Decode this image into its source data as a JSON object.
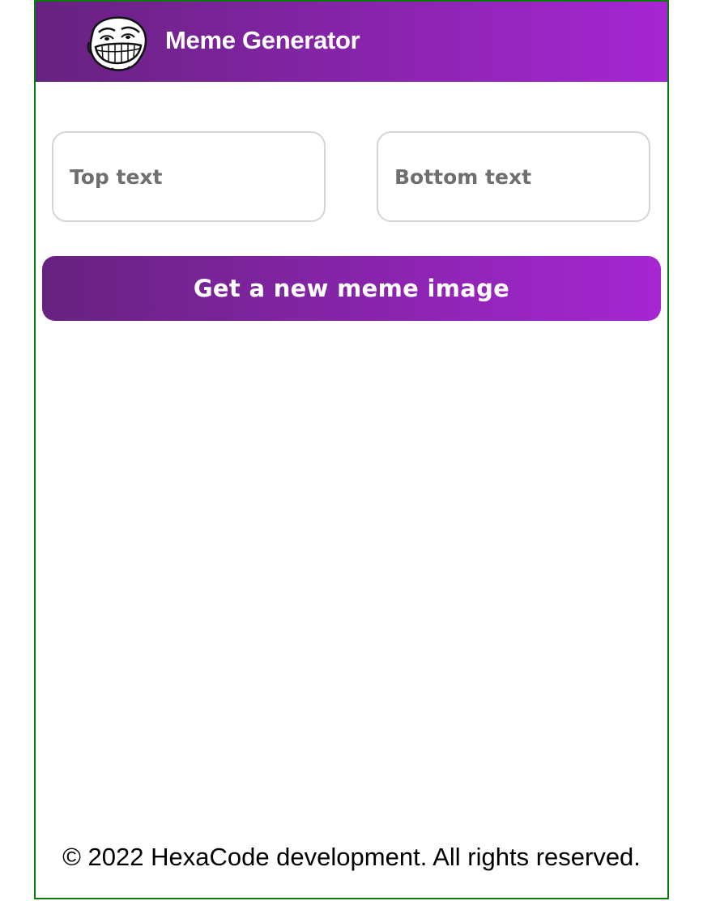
{
  "header": {
    "title": "Meme Generator",
    "logo_icon": "troll-face-icon",
    "gradient_start": "#672280",
    "gradient_end": "#A626D3"
  },
  "form": {
    "top_text_placeholder": "Top text",
    "top_text_value": "",
    "bottom_text_placeholder": "Bottom text",
    "bottom_text_value": "",
    "submit_label": "Get a new meme image"
  },
  "footer": {
    "text": "© 2022 HexaCode development. All rights reserved."
  }
}
